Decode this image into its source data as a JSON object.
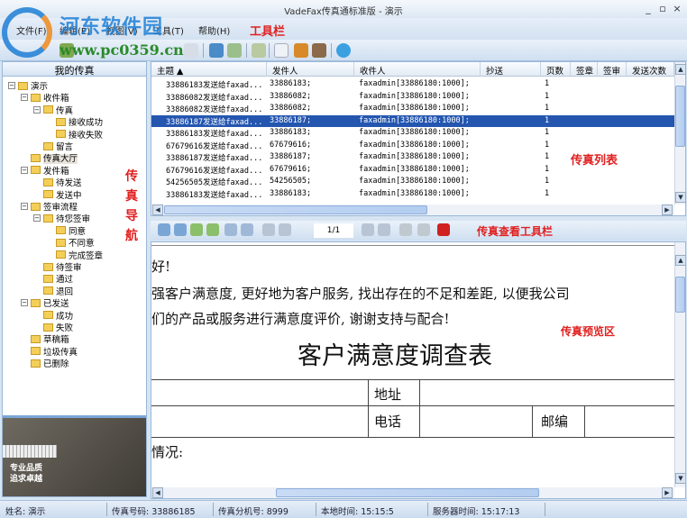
{
  "window": {
    "title": "VadeFax传真通标准版 - 演示",
    "minimize": "_",
    "restore": "▫",
    "close": "×"
  },
  "watermark": {
    "name": "河东软件园",
    "url": "www.pc0359.cn"
  },
  "menu": [
    "文件(F)",
    "编辑(E)",
    "视图(V)",
    "工具(T)",
    "帮助(H)"
  ],
  "annotations": {
    "toolbar": "工具栏",
    "list": "传真列表",
    "nav": [
      "传",
      "真",
      "导",
      "航"
    ],
    "viewer_toolbar": "传真查看工具栏",
    "preview": "传真预览区"
  },
  "toolbar_icons": [
    "new-fax-icon",
    "send-icon",
    "reply-icon",
    "forward-icon",
    "refresh-icon",
    "print-icon",
    "contacts-icon",
    "stamp-icon",
    "help-icon"
  ],
  "nav": {
    "title": "我的传真",
    "items": [
      {
        "label": "演示",
        "level": 0,
        "exp": "⊟",
        "icon": "user-group-icon"
      },
      {
        "label": "收件箱",
        "level": 1,
        "exp": "⊟",
        "icon": "inbox-icon"
      },
      {
        "label": "传真",
        "level": 2,
        "exp": "⊟",
        "icon": "folder-icon"
      },
      {
        "label": "接收成功",
        "level": 3,
        "icon": "folder-icon"
      },
      {
        "label": "接收失败",
        "level": 3,
        "icon": "folder-icon"
      },
      {
        "label": "留言",
        "level": 2,
        "icon": "folder-icon"
      },
      {
        "label": "传真大厅",
        "level": 1,
        "icon": "fax-hall-icon",
        "selected": true
      },
      {
        "label": "发件箱",
        "level": 1,
        "exp": "⊟",
        "icon": "outbox-icon"
      },
      {
        "label": "待发送",
        "level": 2,
        "icon": "folder-icon"
      },
      {
        "label": "发送中",
        "level": 2,
        "icon": "folder-icon"
      },
      {
        "label": "签审流程",
        "level": 1,
        "exp": "⊟",
        "icon": "approval-icon"
      },
      {
        "label": "待您签审",
        "level": 2,
        "exp": "⊟",
        "icon": "folder-icon"
      },
      {
        "label": "同意",
        "level": 3,
        "icon": "folder-icon"
      },
      {
        "label": "不同意",
        "level": 3,
        "icon": "folder-icon"
      },
      {
        "label": "完成签章",
        "level": 3,
        "icon": "folder-icon"
      },
      {
        "label": "待签审",
        "level": 2,
        "icon": "folder-icon"
      },
      {
        "label": "通过",
        "level": 2,
        "icon": "folder-icon"
      },
      {
        "label": "退回",
        "level": 2,
        "icon": "folder-icon"
      },
      {
        "label": "已发送",
        "level": 1,
        "exp": "⊟",
        "icon": "sent-icon"
      },
      {
        "label": "成功",
        "level": 2,
        "icon": "folder-icon"
      },
      {
        "label": "失败",
        "level": 2,
        "icon": "folder-icon"
      },
      {
        "label": "草稿箱",
        "level": 1,
        "icon": "drafts-icon"
      },
      {
        "label": "垃圾传真",
        "level": 1,
        "icon": "junk-icon"
      },
      {
        "label": "已删除",
        "level": 1,
        "icon": "trash-icon"
      }
    ]
  },
  "ad": {
    "line1": "专业品质",
    "line2": "追求卓越"
  },
  "list": {
    "columns": [
      "主题 ▲",
      "发件人",
      "收件人",
      "抄送",
      "页数",
      "签章",
      "签审",
      "发送次数"
    ],
    "rows": [
      [
        "33886183发送给faxad...",
        "33886183;",
        "faxadmin[33886180:1000];",
        "",
        "1"
      ],
      [
        "33886082发送给faxad...",
        "33886082;",
        "faxadmin[33886180:1000];",
        "",
        "1"
      ],
      [
        "33886082发送给faxad...",
        "33886082;",
        "faxadmin[33886180:1000];",
        "",
        "1"
      ],
      [
        "33886187发送给faxad...",
        "33886187;",
        "faxadmin[33886180:1000];",
        "",
        "1"
      ],
      [
        "33886183发送给faxad...",
        "33886183;",
        "faxadmin[33886180:1000];",
        "",
        "1"
      ],
      [
        "67679616发送给faxad...",
        "67679616;",
        "faxadmin[33886180:1000];",
        "",
        "1"
      ],
      [
        "33886187发送给faxad...",
        "33886187;",
        "faxadmin[33886180:1000];",
        "",
        "1"
      ],
      [
        "67679616发送给faxad...",
        "67679616;",
        "faxadmin[33886180:1000];",
        "",
        "1"
      ],
      [
        "54256505发送给faxad...",
        "54256505;",
        "faxadmin[33886180:1000];",
        "",
        "1"
      ],
      [
        "33886183发送给faxad...",
        "33886183;",
        "faxadmin[33886180:1000];",
        "",
        "1"
      ]
    ],
    "selected_row": 3
  },
  "viewer": {
    "page": "1/1",
    "icons": [
      "zoom-in-icon",
      "zoom-out-icon",
      "rotate-left-icon",
      "rotate-right-icon",
      "fit-page-icon",
      "fit-width-icon",
      "first-page-icon",
      "prev-page-icon",
      "next-page-icon",
      "last-page-icon",
      "sign-icon",
      "approve-icon",
      "delete-icon"
    ]
  },
  "preview": {
    "greeting": "好!",
    "line1": "强客户满意度, 更好地为客户服务, 找出存在的不足和差距, 以便我公司",
    "line2": "们的产品或服务进行满意度评价, 谢谢支持与配合!",
    "heading": "客户满意度调查表",
    "address": "地址",
    "phone": "电话",
    "postcode": "邮编",
    "situation": "情况:"
  },
  "status": {
    "name": "姓名: 演示",
    "fax_number": "传真号码: 33886185",
    "extension": "传真分机号: 8999",
    "local_time": "本地时间: 15:15:5",
    "server_time": "服务器时间: 15:17:13"
  }
}
